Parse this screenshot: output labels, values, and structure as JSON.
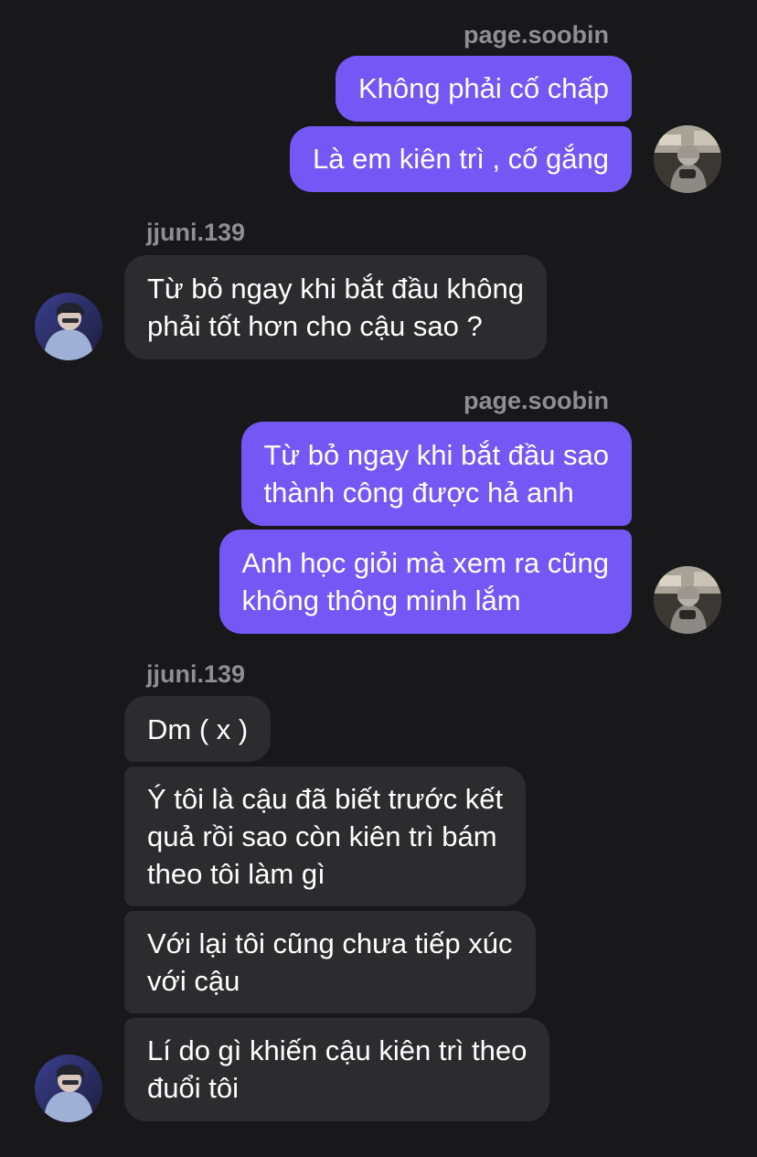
{
  "conversation": {
    "groups": [
      {
        "sender": "page.soobin",
        "side": "right",
        "messages": [
          {
            "lines": [
              "Không phải cố chấp"
            ]
          },
          {
            "lines": [
              "Là em kiên trì , cố gắng"
            ]
          }
        ]
      },
      {
        "sender": "jjuni.139",
        "side": "left",
        "messages": [
          {
            "lines": [
              "Từ bỏ ngay khi bắt đầu không",
              "phải tốt hơn cho cậu sao ?"
            ]
          }
        ]
      },
      {
        "sender": "page.soobin",
        "side": "right",
        "messages": [
          {
            "lines": [
              "Từ bỏ ngay khi bắt đầu sao",
              "thành công được hả anh"
            ]
          },
          {
            "lines": [
              "Anh học giỏi mà xem ra cũng",
              "không thông minh lắm"
            ]
          }
        ]
      },
      {
        "sender": "jjuni.139",
        "side": "left",
        "messages": [
          {
            "lines": [
              "Dm ( x )"
            ]
          },
          {
            "lines": [
              "Ý tôi là cậu đã biết trước kết",
              "quả rồi sao còn kiên trì bám",
              "theo tôi làm gì"
            ]
          },
          {
            "lines": [
              "Với lại tôi cũng chưa tiếp xúc",
              "với cậu"
            ]
          },
          {
            "lines": [
              "Lí do gì khiến cậu kiên trì theo",
              "đuổi tôi"
            ]
          }
        ]
      }
    ]
  },
  "colors": {
    "background": "#18181a",
    "outgoing_bubble": "#7458f5",
    "incoming_bubble": "#2c2c2e",
    "username": "#8e8e93",
    "text": "#ffffff"
  },
  "icons": {
    "sender_avatar": "user-avatar-icon",
    "recipient_avatar": "user-avatar-icon"
  }
}
